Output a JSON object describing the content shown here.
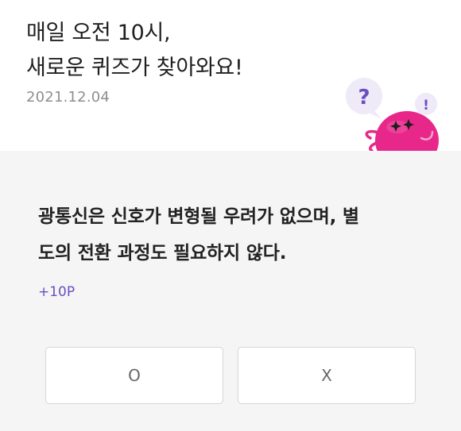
{
  "header": {
    "headline_line1": "매일 오전 10시,",
    "headline_line2": "새로운 퀴즈가 찾아와요!",
    "date": "2021.12.04"
  },
  "mascot": {
    "icon": "quiz-mascot-icon",
    "bubble_glyph_question": "?",
    "bubble_glyph_exclaim": "!",
    "colors": {
      "body": "#e8278a",
      "bubble": "#eeeaf7",
      "glyph": "#6a4fc2"
    }
  },
  "quiz": {
    "question_line1": "광통신은 신호가 변형될 우려가 없으며, 별",
    "question_line2": "도의 전환 과정도 필요하지 않다.",
    "points": "+10P",
    "answers": [
      {
        "label": "O"
      },
      {
        "label": "X"
      }
    ]
  },
  "colors": {
    "accent": "#6a4fc2",
    "card_background": "#f5f5f5"
  }
}
